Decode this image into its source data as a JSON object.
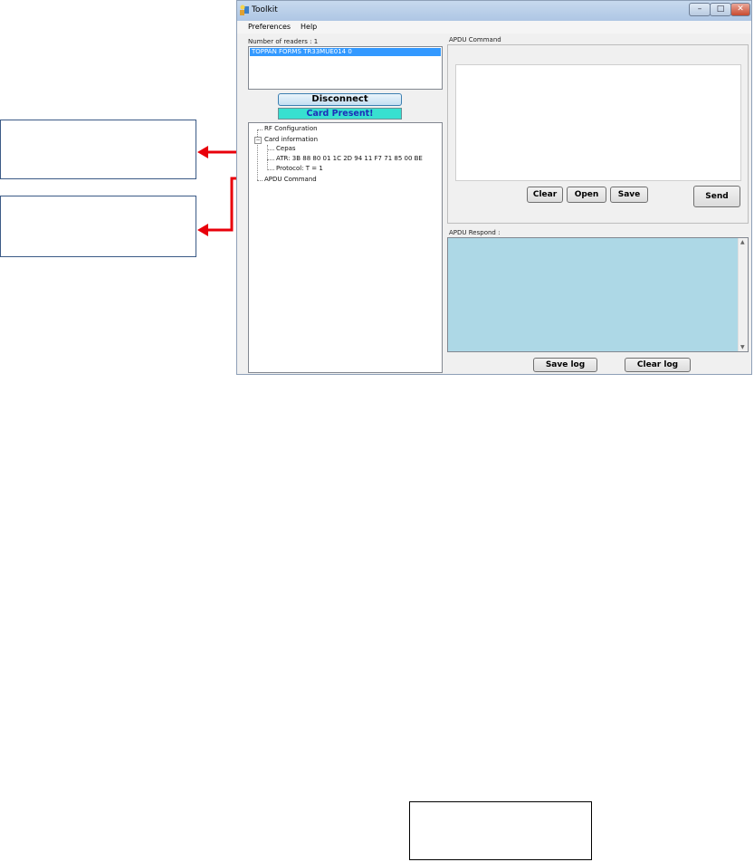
{
  "window": {
    "title": "Toolkit",
    "controls": [
      "–",
      "□",
      "✕"
    ],
    "menu": [
      "Preferences",
      "Help"
    ]
  },
  "readers": {
    "label": "Number of readers : 1",
    "items": [
      "TOPPAN FORMS TR33MUE014 0"
    ]
  },
  "buttons": {
    "disconnect": "Disconnect",
    "clear": "Clear",
    "open": "Open",
    "save": "Save",
    "send": "Send",
    "save_log": "Save log",
    "clear_log": "Clear log"
  },
  "status": "Card Present!",
  "tree": {
    "rf_configuration": "RF Configuration",
    "card_information": "Card information",
    "cepas": "Cepas",
    "atr": "ATR: 3B 88 80 01 1C 2D 94 11 F7 71 85 00 BE",
    "protocol": "Protocol: T = 1",
    "apdu_command": "APDU Command"
  },
  "apdu_command_label": "APDU Command",
  "apdu_respond_label": "APDU Respond :",
  "colors": {
    "accent_arrow": "#e8000b",
    "card_present_bg": "#37e0d0",
    "card_present_text": "#1d2fb8",
    "respond_bg": "#add8e6",
    "selection": "#3399ff"
  }
}
